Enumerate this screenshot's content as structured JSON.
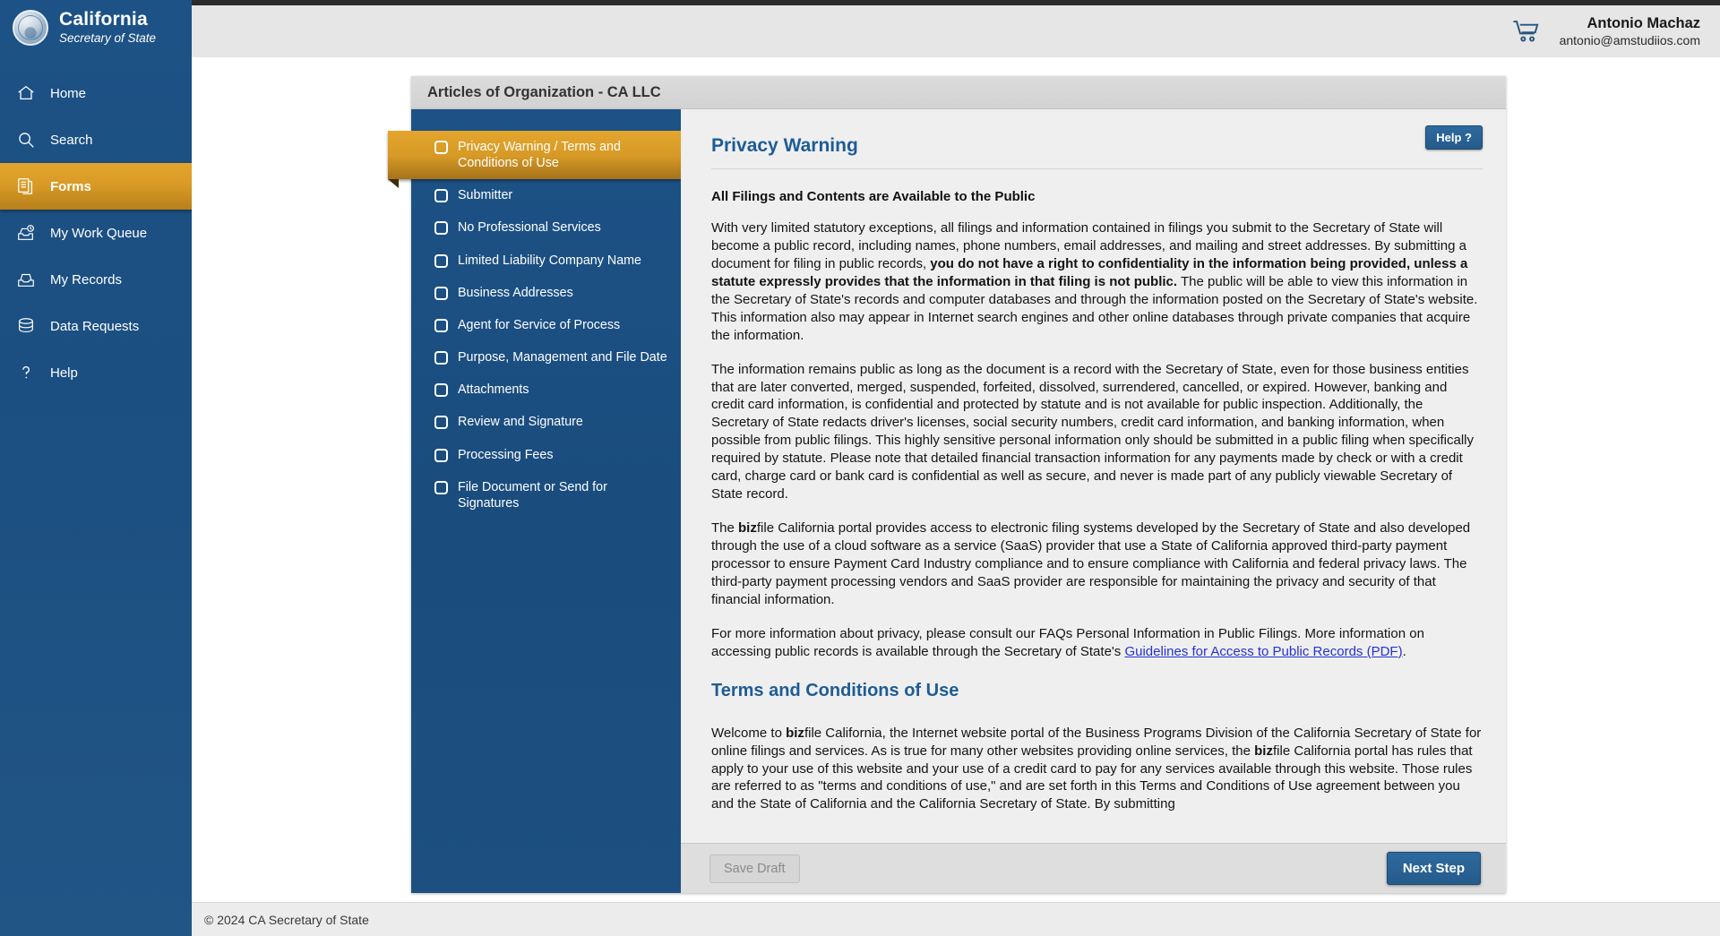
{
  "brand": {
    "title": "California",
    "subtitle": "Secretary of State",
    "seal_icon": "california-state-seal"
  },
  "sidebar": {
    "items": [
      {
        "label": "Home",
        "icon": "home-icon",
        "active": false
      },
      {
        "label": "Search",
        "icon": "search-icon",
        "active": false
      },
      {
        "label": "Forms",
        "icon": "forms-icon",
        "active": true
      },
      {
        "label": "My Work Queue",
        "icon": "work-queue-icon",
        "active": false
      },
      {
        "label": "My Records",
        "icon": "records-icon",
        "active": false
      },
      {
        "label": "Data Requests",
        "icon": "database-icon",
        "active": false
      },
      {
        "label": "Help",
        "icon": "question-mark-icon",
        "active": false
      }
    ]
  },
  "header": {
    "cart_icon": "shopping-cart-icon",
    "user_name": "Antonio Machaz",
    "user_email": "antonio@amstudiios.com"
  },
  "form": {
    "title": "Articles of Organization - CA LLC",
    "steps": [
      {
        "label": "Privacy Warning / Terms and Conditions of Use",
        "checked": false,
        "active": true
      },
      {
        "label": "Submitter",
        "checked": false,
        "active": false
      },
      {
        "label": "No Professional Services",
        "checked": false,
        "active": false
      },
      {
        "label": "Limited Liability Company Name",
        "checked": false,
        "active": false
      },
      {
        "label": "Business Addresses",
        "checked": false,
        "active": false
      },
      {
        "label": "Agent for Service of Process",
        "checked": false,
        "active": false
      },
      {
        "label": "Purpose, Management and File Date",
        "checked": false,
        "active": false
      },
      {
        "label": "Attachments",
        "checked": false,
        "active": false
      },
      {
        "label": "Review and Signature",
        "checked": false,
        "active": false
      },
      {
        "label": "Processing Fees",
        "checked": false,
        "active": false
      },
      {
        "label": "File Document or Send for Signatures",
        "checked": false,
        "active": false
      }
    ]
  },
  "content": {
    "help_label": "Help ?",
    "section_title": "Privacy Warning",
    "lead": "All Filings and Contents are Available to the Public",
    "p1_a": "With very limited statutory exceptions, all filings and information contained in filings you submit to the Secretary of State will become a public record, including names, phone numbers, email addresses, and mailing and street addresses. By submitting a document for filing in public records, ",
    "p1_bold": "you do not have a right to confidentiality in the information being provided, unless a statute expressly provides that the information in that filing is not public.",
    "p1_b": " The public will be able to view this information in the Secretary of State's records and computer databases and through the information posted on the Secretary of State's website. This information also may appear in Internet search engines and other online databases through private companies that acquire the information.",
    "p2": "The information remains public as long as the document is a record with the Secretary of State, even for those business entities that are later converted, merged, suspended, forfeited, dissolved, surrendered, cancelled, or expired. However, banking and credit card information, is confidential and protected by statute and is not available for public inspection. Additionally, the Secretary of State redacts driver's licenses, social security numbers, credit card information, and banking information, when possible from public filings. This highly sensitive personal information only should be submitted in a public filing when specifically required by statute. Please note that detailed financial transaction information for any payments made by check or with a credit card, charge card or bank card is confidential as well as secure, and never is made part of any publicly viewable Secretary of State record.",
    "p3_bold": "biz",
    "p3": "file California portal provides access to electronic filing systems developed by the Secretary of State and also developed through the use of a cloud software as a service (SaaS) provider that use a State of California approved third-party payment processor to ensure Payment Card Industry compliance and to ensure compliance with California and federal privacy laws. The third-party payment processing vendors and SaaS provider are responsible for maintaining the privacy and security of that financial information.",
    "p3_pre": "The ",
    "p4_a": "For more information about privacy, please consult our FAQs Personal Information in Public Filings. More information on accessing public records is available through the Secretary of State's ",
    "p4_link": "Guidelines for Access to Public Records (PDF)",
    "p4_b": ".",
    "section_title2": "Terms and Conditions of Use",
    "p5_a": "Welcome to ",
    "p5_bold1": "biz",
    "p5_b": "file California, the Internet website portal of the Business Programs Division of the California Secretary of State for online filings and services. As is true for many other websites providing online services, the ",
    "p5_bold2": "biz",
    "p5_c": "file California portal has rules that apply to your use of this website and your use of a credit card to pay for any services available through this website. Those rules are referred to as \"terms and conditions of use,\" and are set forth in this Terms and Conditions of Use agreement between you and the State of California and the California Secretary of State. By submitting"
  },
  "actions": {
    "save_draft": "Save Draft",
    "next_step": "Next Step"
  },
  "footer": {
    "copyright": "© 2024 CA Secretary of State"
  },
  "colors": {
    "sidebar_blue": "#1d5286",
    "accent_gold": "#d99b26",
    "link_blue": "#2532d0",
    "heading_blue": "#1d5c96",
    "button_blue": "#255b8b"
  }
}
